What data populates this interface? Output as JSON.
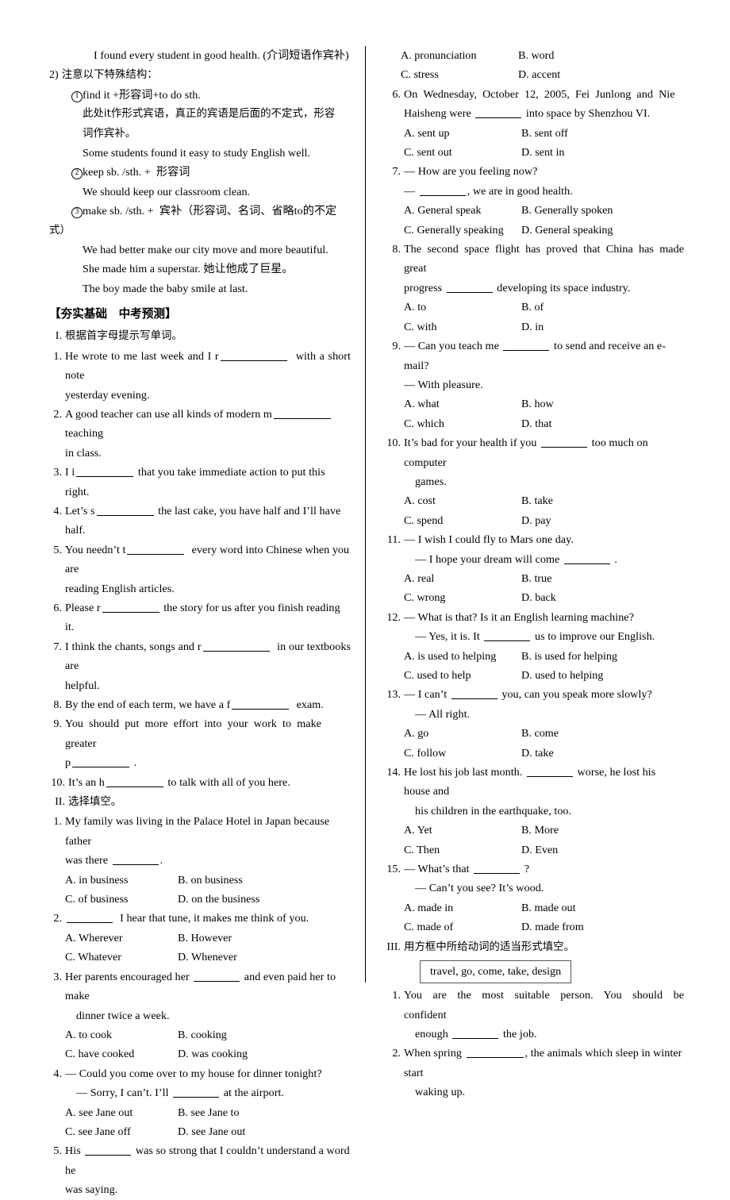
{
  "left_column": {
    "grammar_notes": {
      "example_top": "I found every student in good health. (介词短语作宾补)",
      "point2_num": "2)",
      "point2_text": "注意以下特殊结构：",
      "sub1_circle": "1",
      "sub1_text": "find it +形容词+to do sth.",
      "sub1_explain_line1": "此处it作形式宾语，真正的宾语是后面的不定式，形容",
      "sub1_explain_line2": "词作宾补。",
      "sub1_example": "Some students found it easy to study English well.",
      "sub2_circle": "2",
      "sub2_text": "keep sb. /sth. +  形容词",
      "sub2_example": "We should keep our classroom clean.",
      "sub3_circle": "3",
      "sub3_text": "make sb. /sth. +  宾补（形容词、名词、省略to的不定",
      "sub3_text_wrap": "式）",
      "sub3_example1": "We had better make our city move and more beautiful.",
      "sub3_example2": "She made him a superstar. 她让他成了巨星。",
      "sub3_example3": "The boy made the baby smile at last."
    },
    "section_header": "【夯实基础　中考预测】",
    "part1_label": "I.",
    "part1_title": "根据首字母提示写单词。",
    "part1_items": [
      {
        "num": "1.",
        "line1": "He wrote to me last week and I r",
        "blank": "b-xl",
        "line2": "  with a short note",
        "cont": "yesterday evening."
      },
      {
        "num": "2.",
        "line1": "A good teacher can use all kinds of modern m",
        "blank": "b-l",
        "line2": "  teaching",
        "cont": "in class."
      },
      {
        "num": "3.",
        "line1": "I i",
        "blank": "b-l",
        "line2": " that you take immediate action to put this right.",
        "cont": ""
      },
      {
        "num": "4.",
        "line1": "Let’s s",
        "blank": "b-l",
        "line2": " the last cake, you have half and I’ll have half.",
        "cont": ""
      },
      {
        "num": "5.",
        "line1": "You needn’t t",
        "blank": "b-l",
        "line2": "  every word into Chinese when you are",
        "cont": "reading English articles."
      },
      {
        "num": "6.",
        "line1": "Please r",
        "blank": "b-l",
        "line2": " the story for us after you finish reading it.",
        "cont": ""
      },
      {
        "num": "7.",
        "line1": "I think the chants, songs and r",
        "blank": "b-xl",
        "line2": "  in our textbooks are",
        "cont": "helpful."
      },
      {
        "num": "8.",
        "line1": "By the end of each term, we have a f",
        "blank": "b-l",
        "line2": "  exam.",
        "cont": ""
      },
      {
        "num": "9.",
        "line1": "You  should  put  more  effort  into  your  work  to  make  greater",
        "blank": "b-l",
        "line2": "",
        "cont": "p_____ ."
      },
      {
        "num": "10.",
        "line1": "It’s an h",
        "blank": "b-l",
        "line2": " to talk with all of you here.",
        "cont": ""
      }
    ],
    "item9_cont_prefix": "p",
    "item9_cont_suffix": " .",
    "part2_label": "II.",
    "part2_title": "选择填空。",
    "part2_items": [
      {
        "num": "1.",
        "stem_lines": [
          "My family was living in the Palace Hotel in Japan because father",
          "was there "
        ],
        "stem_blank_after": ".",
        "options": [
          [
            "A. in business",
            "B. on business"
          ],
          [
            "C. of business",
            "D. on the business"
          ]
        ]
      },
      {
        "num": "2.",
        "stem_lines": [
          "",
          "  I hear that tune, it makes me think of you."
        ],
        "stem_blank_after": "",
        "options": [
          [
            "A. Wherever",
            "B. However"
          ],
          [
            "C. Whatever",
            "D. Whenever"
          ]
        ]
      },
      {
        "num": "3.",
        "stem_lines": [
          "Her parents encouraged her ",
          " and even paid her to make",
          "dinner twice a week."
        ],
        "stem_blank_after": "",
        "options": [
          [
            "A. to cook",
            "B. cooking"
          ],
          [
            "C. have cooked",
            "D. was cooking"
          ]
        ]
      },
      {
        "num": "4.",
        "stem_lines": [
          "— Could you come over to my house for dinner tonight?",
          "— Sorry, I can’t. I’ll ",
          " at the airport."
        ],
        "stem_blank_after": "",
        "options": [
          [
            "A. see Jane out",
            "B. see Jane to"
          ],
          [
            "C. see Jane off",
            "D. see Jane out"
          ]
        ]
      },
      {
        "num": "5.",
        "stem_lines": [
          "His ",
          " was so strong that I couldn’t understand a word he",
          "was saying."
        ],
        "stem_blank_after": "",
        "options": []
      }
    ]
  },
  "right_column": {
    "q5_options": [
      [
        "A. pronunciation",
        "B. word"
      ],
      [
        "C. stress",
        "D. accent"
      ]
    ],
    "items": [
      {
        "num": "6.",
        "stem_lines": [
          "On  Wednesday,  October  12,  2005,  Fei  Junlong  and  Nie",
          "Haisheng were ",
          " into space by Shenzhou VI."
        ],
        "options": [
          [
            "A. sent up",
            "B. sent off"
          ],
          [
            "C. sent out",
            "D. sent in"
          ]
        ]
      },
      {
        "num": "7.",
        "stem_lines": [
          "— How are you feeling now?",
          "— ",
          ", we are in good health."
        ],
        "options": [
          [
            "A. General speak",
            "B. Generally spoken"
          ],
          [
            "C. Generally speaking",
            "D. General speaking"
          ]
        ]
      },
      {
        "num": "8.",
        "stem_lines": [
          "The  second  space  flight  has  proved  that  China  has  made  great",
          "progress ",
          " developing its space industry."
        ],
        "options": [
          [
            "A. to",
            "B. of"
          ],
          [
            "C. with",
            "D. in"
          ]
        ]
      },
      {
        "num": "9.",
        "stem_lines": [
          "— Can you teach me ",
          " to send and receive an e-mail?",
          "— With pleasure."
        ],
        "options": [
          [
            "A. what",
            "B. how"
          ],
          [
            "C. which",
            "D. that"
          ]
        ]
      },
      {
        "num": "10.",
        "stem_lines": [
          "It’s bad for your health if you ",
          " too much on computer",
          "games."
        ],
        "options": [
          [
            "A. cost",
            "B. take"
          ],
          [
            "C. spend",
            "D. pay"
          ]
        ]
      },
      {
        "num": "11.",
        "stem_lines": [
          "— I wish I could fly to Mars one day.",
          "— I hope your dream will come ",
          " ."
        ],
        "options": [
          [
            "A. real",
            "B. true"
          ],
          [
            "C. wrong",
            "D. back"
          ]
        ]
      },
      {
        "num": "12.",
        "stem_lines": [
          "— What is that? Is it an English learning machine?",
          "— Yes, it is. It ",
          " us to improve our English."
        ],
        "options": [
          [
            "A. is used to helping",
            "B. is used for helping"
          ],
          [
            "C. used to help",
            "D. used to helping"
          ]
        ]
      },
      {
        "num": "13.",
        "stem_lines": [
          "— I can’t ",
          " you, can you speak more slowly?",
          "— All right."
        ],
        "options": [
          [
            "A. go",
            "B. come"
          ],
          [
            "C. follow",
            "D. take"
          ]
        ]
      },
      {
        "num": "14.",
        "stem_lines": [
          "He lost his job last month. ",
          " worse, he lost his house and",
          "his children in the earthquake, too."
        ],
        "options": [
          [
            "A. Yet",
            "B. More"
          ],
          [
            "C. Then",
            "D. Even"
          ]
        ]
      },
      {
        "num": "15.",
        "stem_lines": [
          "— What’s that ",
          " ?",
          "— Can’t you see? It’s wood."
        ],
        "options": [
          [
            "A. made in",
            "B. made out"
          ],
          [
            "C. made of",
            "D. made from"
          ]
        ]
      }
    ],
    "part3_label": "III.",
    "part3_title": "用方框中所给动词的适当形式填空。",
    "word_box": "travel, go, come, take, design",
    "part3_items": [
      {
        "num": "1.",
        "line1": "You  are  the  most  suitable  person.  You  should  be  confident",
        "line2_pre": "enough ",
        "line2_post": " the job."
      },
      {
        "num": "2.",
        "line1_pre": "When spring ",
        "line1_post": ", the animals which sleep in winter start",
        "line2": "waking up."
      }
    ]
  }
}
